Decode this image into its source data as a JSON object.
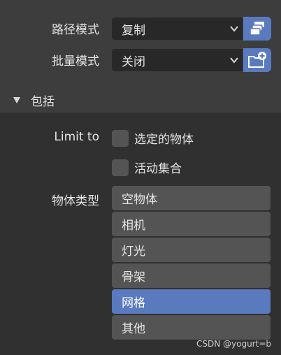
{
  "settings": {
    "path_mode": {
      "label": "路径模式",
      "value": "复制",
      "icon": "copy-icon"
    },
    "batch_mode": {
      "label": "批量模式",
      "value": "关闭",
      "icon": "new-folder-icon"
    }
  },
  "include_section": {
    "title": "包括",
    "limit_to_label": "Limit to",
    "checkboxes": [
      {
        "label": "选定的物体",
        "checked": false
      },
      {
        "label": "活动集合",
        "checked": false
      }
    ],
    "object_types_label": "物体类型",
    "object_types": [
      {
        "label": "空物体",
        "selected": false
      },
      {
        "label": "相机",
        "selected": false
      },
      {
        "label": "灯光",
        "selected": false
      },
      {
        "label": "骨架",
        "selected": false
      },
      {
        "label": "网格",
        "selected": true
      },
      {
        "label": "其他",
        "selected": false
      }
    ]
  },
  "watermark": "CSDN @yogurt=b",
  "colors": {
    "accent": "#5a7ac0",
    "panel": "#3d3d3d",
    "field": "#282828",
    "button": "#545454"
  }
}
